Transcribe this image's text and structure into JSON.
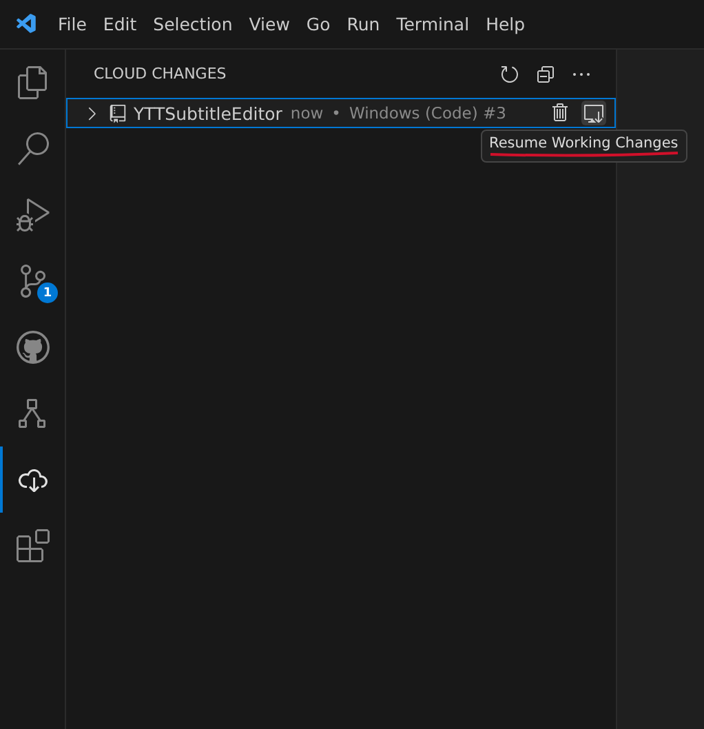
{
  "menu": [
    "File",
    "Edit",
    "Selection",
    "View",
    "Go",
    "Run",
    "Terminal",
    "Help"
  ],
  "activity_bar": [
    {
      "kind": "explorer",
      "selected": false
    },
    {
      "kind": "search",
      "selected": false
    },
    {
      "kind": "debug",
      "selected": false
    },
    {
      "kind": "source-control",
      "selected": false,
      "badge": "1"
    },
    {
      "kind": "github",
      "selected": false
    },
    {
      "kind": "hierarchy",
      "selected": false
    },
    {
      "kind": "cloud",
      "selected": true
    },
    {
      "kind": "extensions",
      "selected": false
    }
  ],
  "sidebar": {
    "title": "CLOUD CHANGES",
    "actions": [
      {
        "kind": "refresh"
      },
      {
        "kind": "collapse"
      },
      {
        "kind": "more"
      }
    ],
    "items": [
      {
        "label": "YTTSubtitleEditor",
        "time": "now",
        "separator": "•",
        "description": "Windows (Code) #3",
        "expanded": false,
        "selected": true
      }
    ]
  },
  "tooltip": {
    "text": "Resume Working Changes",
    "underlined": true
  }
}
